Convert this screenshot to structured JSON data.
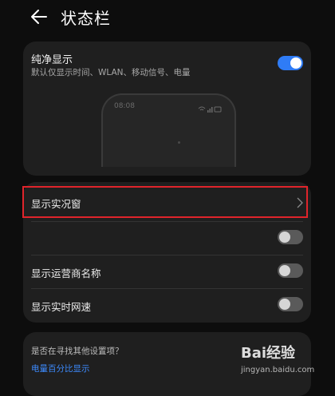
{
  "header": {
    "title": "状态栏"
  },
  "pure_display": {
    "title": "纯净显示",
    "description": "默认仅显示时间、WLAN、移动信号、电量",
    "enabled": true,
    "preview_time": "08:08"
  },
  "settings": {
    "rows": [
      {
        "label": "显示实况窗",
        "control": "chevron"
      },
      {
        "label": "",
        "control": "toggle",
        "enabled": false
      },
      {
        "label": "显示运营商名称",
        "control": "toggle",
        "enabled": false
      },
      {
        "label": "显示实时网速",
        "control": "toggle",
        "enabled": false
      }
    ]
  },
  "suggestions": {
    "question": "是否在寻找其他设置项？",
    "link": "电量百分比显示"
  },
  "watermark": {
    "brand": "Bai经验",
    "url": "jingyan.baidu.com"
  },
  "colors": {
    "accent": "#2f7cf6",
    "link": "#3d8bff",
    "highlight": "#e0242b"
  }
}
